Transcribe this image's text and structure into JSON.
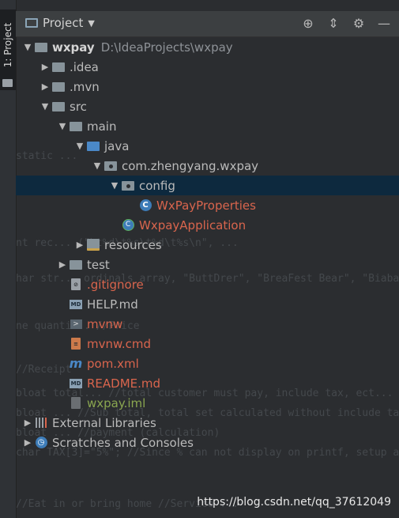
{
  "sidebar": {
    "tab_label": "1: Project"
  },
  "header": {
    "title": "Project",
    "icons": [
      "target-icon",
      "collapse-icon",
      "gear-icon",
      "minimize-icon"
    ]
  },
  "tree": [
    {
      "label": "wxpay",
      "path": "D:\\IdeaProjects\\wxpay",
      "depth": 0,
      "expanded": true,
      "icon": "folder-icon",
      "style": "bold"
    },
    {
      "label": ".idea",
      "depth": 1,
      "expanded": false,
      "icon": "folder-icon",
      "style": "normal"
    },
    {
      "label": ".mvn",
      "depth": 1,
      "expanded": false,
      "icon": "folder-icon",
      "style": "normal"
    },
    {
      "label": "src",
      "depth": 1,
      "expanded": true,
      "icon": "folder-icon",
      "style": "normal"
    },
    {
      "label": "main",
      "depth": 2,
      "expanded": true,
      "icon": "folder-icon",
      "style": "normal"
    },
    {
      "label": "java",
      "depth": 3,
      "expanded": true,
      "icon": "source-folder-icon",
      "style": "normal"
    },
    {
      "label": "com.zhengyang.wxpay",
      "depth": 4,
      "expanded": true,
      "icon": "package-icon",
      "style": "normal"
    },
    {
      "label": "config",
      "depth": 5,
      "expanded": true,
      "icon": "package-icon",
      "style": "normal",
      "selected": true
    },
    {
      "label": "WxPayProperties",
      "depth": 6,
      "icon": "class-icon",
      "style": "red"
    },
    {
      "label": "WxpayApplication",
      "depth": 5,
      "icon": "spring-app-icon",
      "style": "red"
    },
    {
      "label": "resources",
      "depth": 3,
      "expanded": false,
      "icon": "resources-folder-icon",
      "style": "normal"
    },
    {
      "label": "test",
      "depth": 2,
      "expanded": false,
      "icon": "folder-icon",
      "style": "normal"
    },
    {
      "label": ".gitignore",
      "depth": 2,
      "icon": "ignore-file-icon",
      "style": "red"
    },
    {
      "label": "HELP.md",
      "depth": 2,
      "icon": "markdown-icon",
      "style": "normal"
    },
    {
      "label": "mvnw",
      "depth": 2,
      "icon": "terminal-file-icon",
      "style": "red"
    },
    {
      "label": "mvnw.cmd",
      "depth": 2,
      "icon": "cmd-file-icon",
      "style": "red"
    },
    {
      "label": "pom.xml",
      "depth": 2,
      "icon": "maven-icon",
      "style": "red"
    },
    {
      "label": "README.md",
      "depth": 2,
      "icon": "markdown-icon",
      "style": "red"
    },
    {
      "label": "wxpay.iml",
      "depth": 2,
      "icon": "iml-file-icon",
      "style": "green"
    },
    {
      "label": "External Libraries",
      "depth": 0,
      "expanded": false,
      "icon": "libraries-icon",
      "style": "normal"
    },
    {
      "label": "Scratches and Consoles",
      "depth": 0,
      "expanded": false,
      "icon": "scratches-icon",
      "style": "normal"
    }
  ],
  "watermark": "https://blog.csdn.net/qq_37612049"
}
